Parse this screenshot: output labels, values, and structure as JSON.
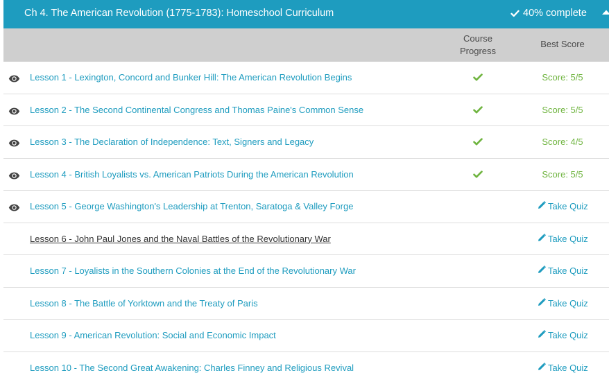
{
  "chapter": {
    "title": "Ch 4. The American Revolution (1775-1783): Homeschool Curriculum",
    "progress_text": "40% complete",
    "progress_fraction": 0.4
  },
  "columns": {
    "progress_line1": "Course",
    "progress_line2": "Progress",
    "score": "Best Score"
  },
  "colors": {
    "header_bg": "#1e9cbf",
    "link": "#1e9cbf",
    "check": "#6fb43f",
    "score": "#6fb43f"
  },
  "lessons": [
    {
      "title": "Lesson 1 - Lexington, Concord and Bunker Hill: The American Revolution Begins",
      "viewed": true,
      "completed": true,
      "score": "Score: 5/5"
    },
    {
      "title": "Lesson 2 - The Second Continental Congress and Thomas Paine's Common Sense",
      "viewed": true,
      "completed": true,
      "score": "Score: 5/5"
    },
    {
      "title": "Lesson 3 - The Declaration of Independence: Text, Signers and Legacy",
      "viewed": true,
      "completed": true,
      "score": "Score: 4/5"
    },
    {
      "title": "Lesson 4 - British Loyalists vs. American Patriots During the American Revolution",
      "viewed": true,
      "completed": true,
      "score": "Score: 5/5"
    },
    {
      "title": "Lesson 5 - George Washington's Leadership at Trenton, Saratoga & Valley Forge",
      "viewed": true,
      "completed": false,
      "action": "Take Quiz"
    },
    {
      "title": "Lesson 6 - John Paul Jones and the Naval Battles of the Revolutionary War",
      "viewed": false,
      "completed": false,
      "hovered": true,
      "action": "Take Quiz"
    },
    {
      "title": "Lesson 7 - Loyalists in the Southern Colonies at the End of the Revolutionary War",
      "viewed": false,
      "completed": false,
      "action": "Take Quiz"
    },
    {
      "title": "Lesson 8 - The Battle of Yorktown and the Treaty of Paris",
      "viewed": false,
      "completed": false,
      "action": "Take Quiz"
    },
    {
      "title": "Lesson 9 - American Revolution: Social and Economic Impact",
      "viewed": false,
      "completed": false,
      "action": "Take Quiz"
    },
    {
      "title": "Lesson 10 - The Second Great Awakening: Charles Finney and Religious Revival",
      "viewed": false,
      "completed": false,
      "action": "Take Quiz"
    }
  ]
}
